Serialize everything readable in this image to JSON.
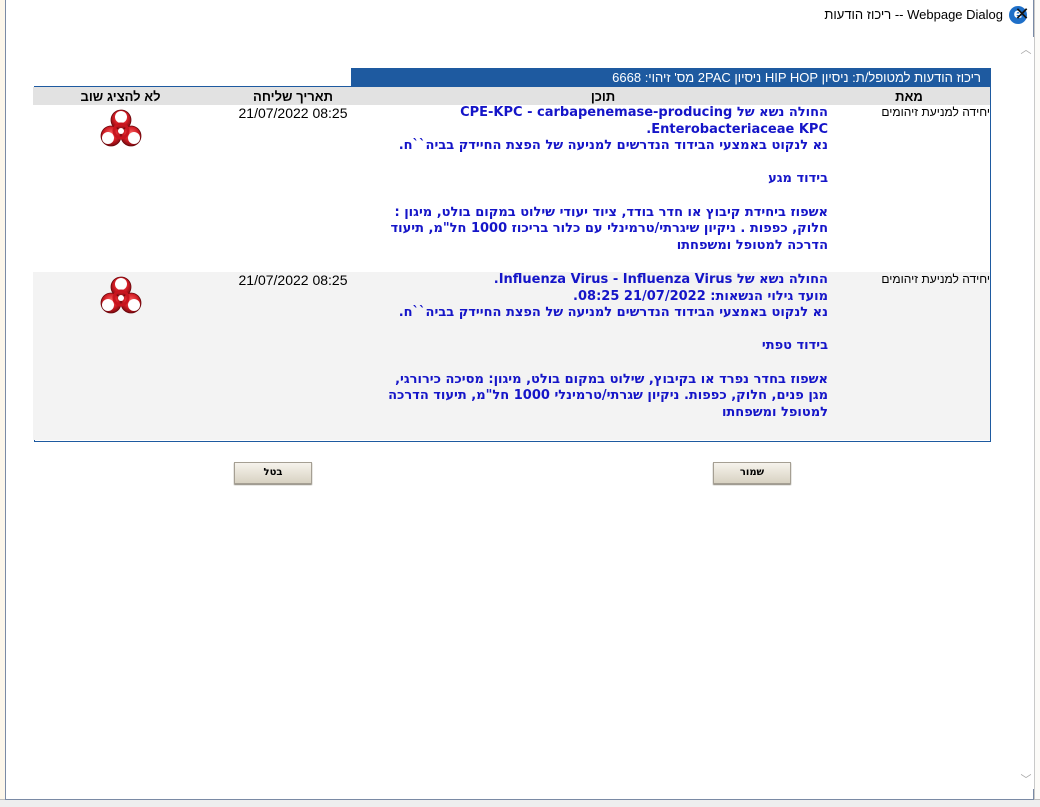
{
  "window": {
    "title": "Webpage Dialog -- ריכוז הודעות",
    "close_glyph": "✕",
    "icon_letter": "e"
  },
  "panel": {
    "header": "ריכוז הודעות למטופל/ת: ניסיון HIP HOP ניסיון 2PAC מס' זיהוי: 6668"
  },
  "table": {
    "columns": {
      "from": "מאת",
      "content": "תוכן",
      "date": "תאריך שליחה",
      "hide": "לא להציג שוב"
    },
    "rows": [
      {
        "from": "יחידה למניעת זיהומים",
        "date": "21/07/2022 08:25",
        "hide_icon": "biohazard-icon",
        "content_lines": [
          "החולה נשא של CPE-KPC - carbapenemase-producing Enterobacteriaceae KPC.",
          "נא לנקוט באמצעי הבידוד הנדרשים למניעה של הפצת החיידק בביה``ח.",
          "",
          "בידוד מגע",
          "",
          "אשפוז ביחידת קיבוץ או חדר בודד, ציוד יעודי שילוט במקום בולט, מיגון : חלוק, כפפות . ניקיון שיגרתי/טרמינלי עם כלור בריכוז 1000 חל\"מ, תיעוד הדרכה למטופל ומשפחתו"
        ]
      },
      {
        "from": "יחידה למניעת זיהומים",
        "date": "21/07/2022 08:25",
        "hide_icon": "biohazard-icon",
        "content_lines": [
          "החולה נשא של Influenza Virus - Influenza Virus.",
          "מועד גילוי הנשאות: 21/07/2022 08:25.",
          "נא לנקוט באמצעי הבידוד הנדרשים למניעה של הפצת החיידק בביה``ח.",
          "",
          "בידוד טפתי",
          "",
          "אשפוז בחדר נפרד או בקיבוץ, שילוט במקום בולט, מיגון: מסיכה כירורגי, מגן פנים, חלוק, כפפות. ניקיון שגרתי/טרמינלי 1000 חל\"מ, תיעוד הדרכה למטופל ומשפחתו"
        ]
      }
    ]
  },
  "buttons": {
    "save": "שמור",
    "cancel": "בטל"
  },
  "colors": {
    "header_blue": "#1e5aa0",
    "content_text": "#1515c8",
    "biohazard_red": "#c8141e"
  }
}
